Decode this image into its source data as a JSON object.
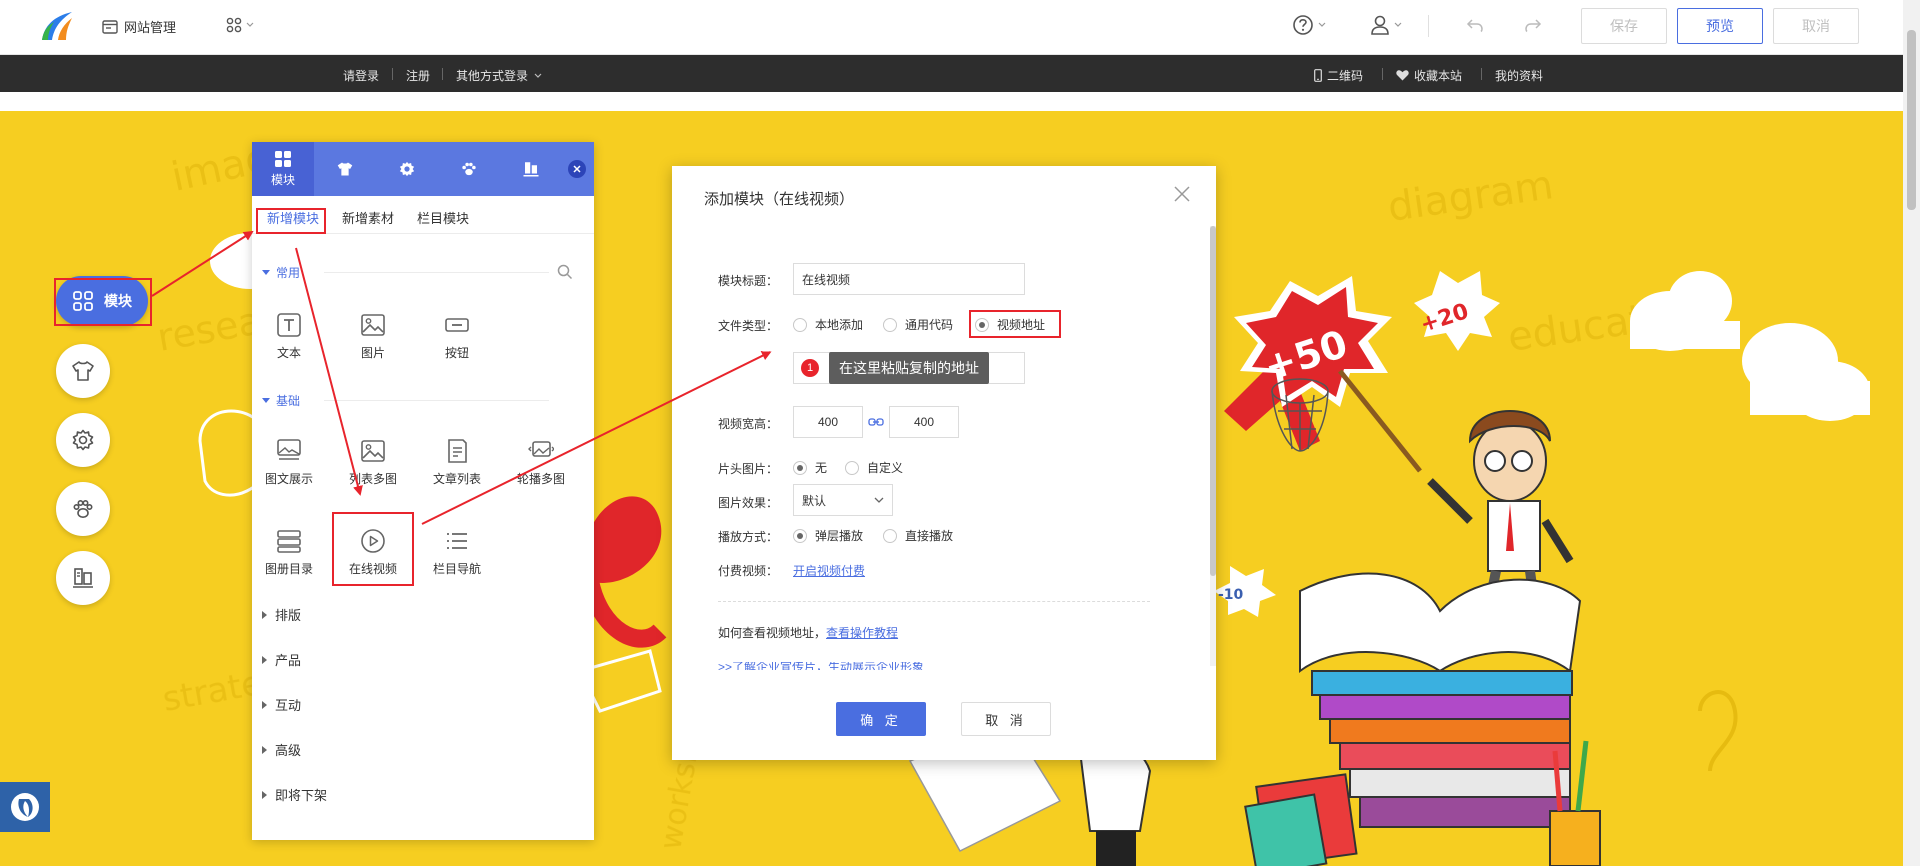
{
  "topbar": {
    "site_manage_label": "网站管理",
    "save_label": "保存",
    "preview_label": "预览",
    "cancel_label": "取消"
  },
  "sitebar": {
    "login": "请登录",
    "register": "注册",
    "other_login": "其他方式登录",
    "qrcode": "二维码",
    "favorite": "收藏本站",
    "profile": "我的资料"
  },
  "leftnav": {
    "module_label": "模块"
  },
  "panel": {
    "head_tab_module": "模块",
    "subtabs": [
      "新增模块",
      "新增素材",
      "栏目模块"
    ],
    "section_common": "常用",
    "common_items": [
      "文本",
      "图片",
      "按钮"
    ],
    "section_basic": "基础",
    "basic_items": [
      "图文展示",
      "列表多图",
      "文章列表",
      "轮播多图",
      "图册目录",
      "在线视频",
      "栏目导航"
    ],
    "categories": [
      "排版",
      "产品",
      "互动",
      "高级",
      "即将下架"
    ]
  },
  "dialog": {
    "title": "添加模块（在线视频）",
    "label_title": "模块标题：",
    "title_value": "在线视频",
    "label_file_type": "文件类型：",
    "file_type_options": [
      "本地添加",
      "通用代码",
      "视频地址"
    ],
    "tooltip": "在这里粘贴复制的地址",
    "tooltip_number": "1",
    "label_size": "视频宽高：",
    "width_value": "400",
    "height_value": "400",
    "label_cover": "片头图片：",
    "cover_options": [
      "无",
      "自定义"
    ],
    "label_effect": "图片效果：",
    "effect_value": "默认",
    "label_play": "播放方式：",
    "play_options": [
      "弹层播放",
      "直接播放"
    ],
    "label_paid": "付费视频：",
    "paid_link": "开启视频付费",
    "howto_text": "如何查看视频地址，",
    "howto_link": "查看操作教程",
    "promo_text": ">>了解企业宣传片，生动展示企业形象",
    "ok_label": "确 定",
    "cancel_label": "取 消"
  },
  "banner": {
    "badge_50": "+50",
    "badge_20": "+20",
    "badge_10": "-10"
  },
  "colors": {
    "accent": "#4a6ee0",
    "highlight": "#e8242c",
    "banner": "#f6ce21"
  }
}
